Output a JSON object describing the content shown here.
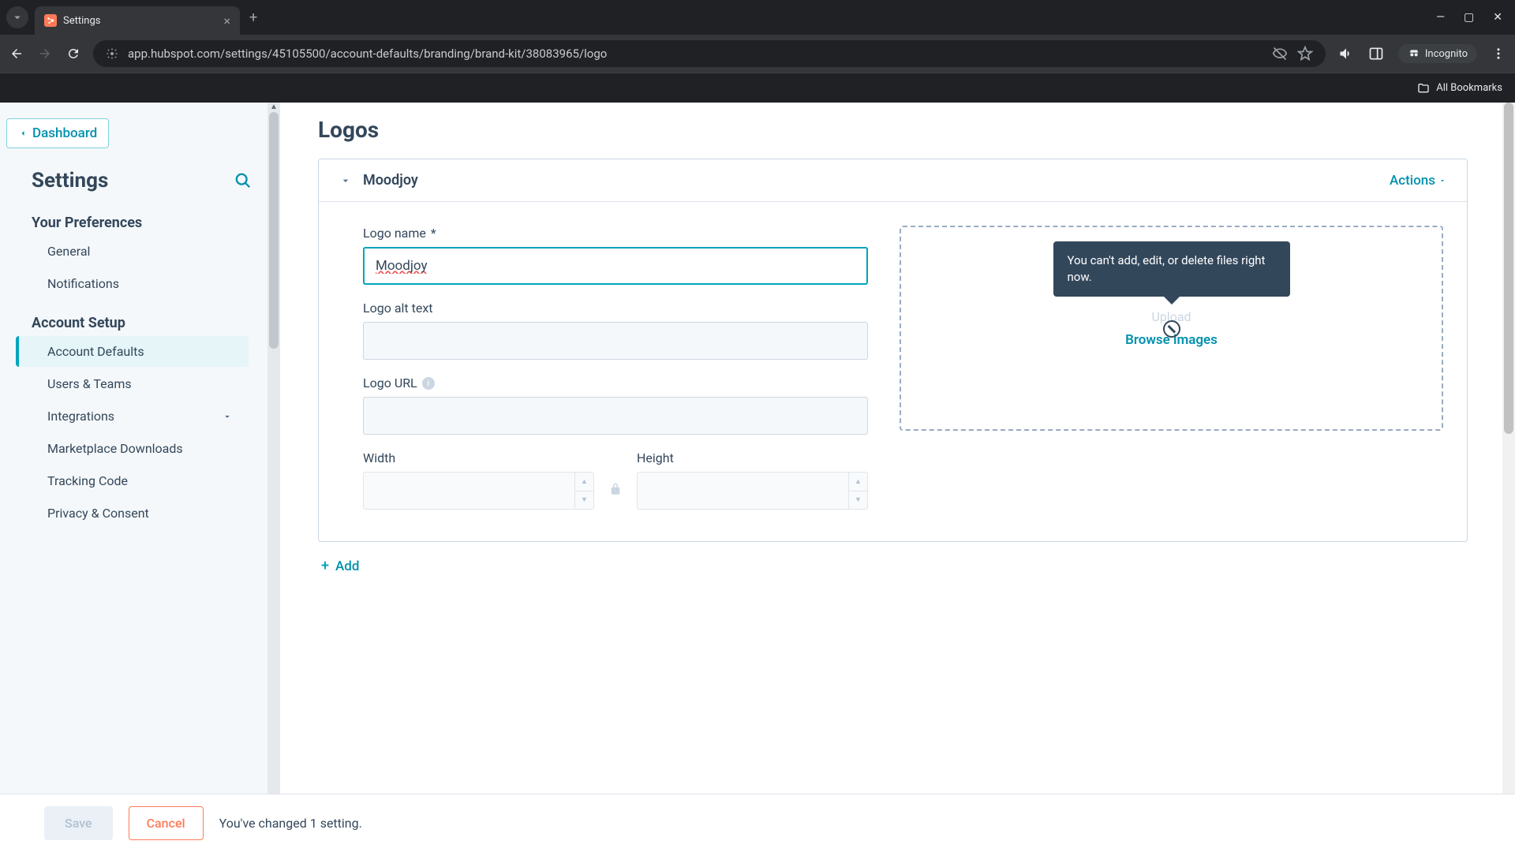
{
  "browser": {
    "tab_title": "Settings",
    "url": "app.hubspot.com/settings/45105500/account-defaults/branding/brand-kit/38083965/logo",
    "incognito_label": "Incognito",
    "all_bookmarks": "All Bookmarks"
  },
  "sidebar": {
    "dashboard_label": "Dashboard",
    "settings_heading": "Settings",
    "your_preferences_heading": "Your Preferences",
    "general": "General",
    "notifications": "Notifications",
    "account_setup_heading": "Account Setup",
    "account_defaults": "Account Defaults",
    "users_teams": "Users & Teams",
    "integrations": "Integrations",
    "marketplace_downloads": "Marketplace Downloads",
    "tracking_code": "Tracking Code",
    "privacy_consent": "Privacy & Consent"
  },
  "page": {
    "title": "Logos",
    "card_title": "Moodjoy",
    "actions_label": "Actions",
    "logo_name_label": "Logo name",
    "logo_name_value": "Moodjoy",
    "logo_alt_label": "Logo alt text",
    "logo_alt_value": "",
    "logo_url_label": "Logo URL",
    "logo_url_value": "",
    "width_label": "Width",
    "height_label": "Height",
    "upload_label": "Upload",
    "browse_label": "Browse images",
    "tooltip_text": "You can't add, edit, or delete files right now.",
    "add_label": "Add"
  },
  "savebar": {
    "save_label": "Save",
    "cancel_label": "Cancel",
    "note": "You've changed 1 setting."
  }
}
